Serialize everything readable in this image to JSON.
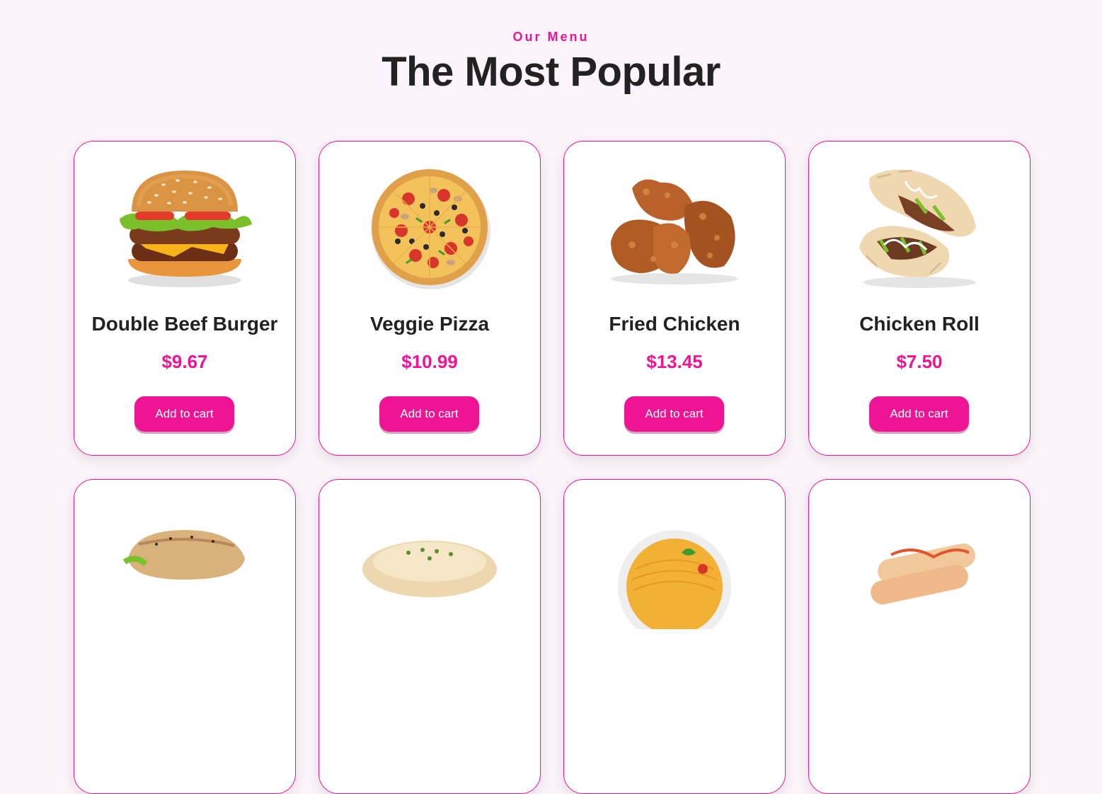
{
  "section": {
    "eyebrow": "Our Menu",
    "title": "The Most Popular"
  },
  "colors": {
    "accent": "#ee1493",
    "background": "#fdf4fb"
  },
  "items": [
    {
      "name": "Double Beef Burger",
      "price": "$9.67",
      "button": "Add to cart",
      "image": "burger"
    },
    {
      "name": "Veggie Pizza",
      "price": "$10.99",
      "button": "Add to cart",
      "image": "pizza"
    },
    {
      "name": "Fried Chicken",
      "price": "$13.45",
      "button": "Add to cart",
      "image": "fried-chicken"
    },
    {
      "name": "Chicken Roll",
      "price": "$7.50",
      "button": "Add to cart",
      "image": "chicken-roll"
    },
    {
      "name": "",
      "price": "",
      "button": "",
      "image": "sandwich"
    },
    {
      "name": "",
      "price": "",
      "button": "",
      "image": "flatbread"
    },
    {
      "name": "",
      "price": "",
      "button": "",
      "image": "spaghetti"
    },
    {
      "name": "",
      "price": "",
      "button": "",
      "image": "spring-rolls"
    }
  ]
}
